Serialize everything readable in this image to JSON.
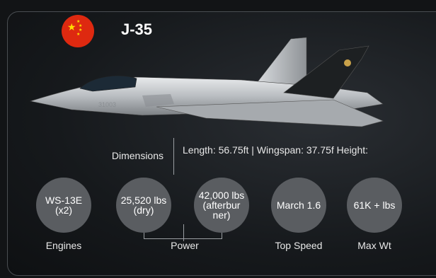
{
  "aircraft": {
    "name": "J-35"
  },
  "flag": {
    "country": "China",
    "icon": "china-flag-icon",
    "background": "#de2910",
    "star_color": "#ffde00"
  },
  "dimensions": {
    "label": "Dimensions",
    "value": "Length: 56.75ft | Wingspan: 37.75f Height:"
  },
  "stats": {
    "engines": {
      "value": "WS-13E (x2)",
      "label": "Engines"
    },
    "power_dry": {
      "value": "25,520 lbs (dry)"
    },
    "power_afterburner": {
      "value": "42,000 lbs (afterbur ner)"
    },
    "power_label": "Power",
    "top_speed": {
      "value": "March 1.6",
      "label": "Top Speed"
    },
    "max_weight": {
      "value": "61K + lbs",
      "label": "Max Wt"
    }
  },
  "colors": {
    "circle": "#5a5d61",
    "card_border": "#4a4e52"
  }
}
